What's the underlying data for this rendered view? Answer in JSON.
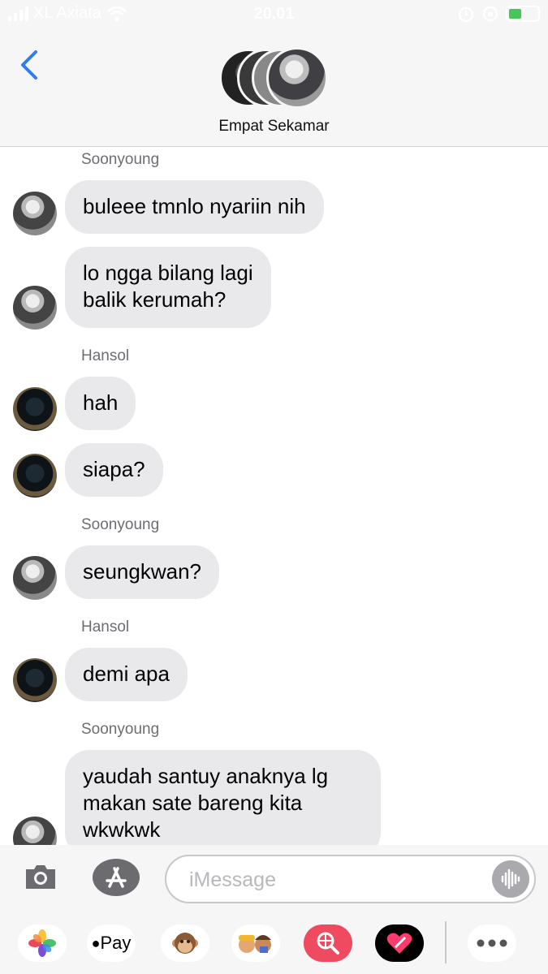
{
  "status": {
    "carrier": "XL Axiata",
    "time": "20.01"
  },
  "header": {
    "group_name": "Empat Sekamar"
  },
  "messages": [
    {
      "sender": "Soonyoung",
      "text": "buleee tmnlo nyariin nih"
    },
    {
      "text": "lo ngga bilang lagi\nbalik kerumah?"
    },
    {
      "sender": "Hansol",
      "text": "hah"
    },
    {
      "text": "siapa?"
    },
    {
      "sender": "Soonyoung",
      "text": "seungkwan?"
    },
    {
      "sender": "Hansol",
      "text": "demi apa"
    },
    {
      "sender": "Soonyoung",
      "text": "yaudah santuy anaknya lg\nmakan sate bareng kita\nwkwkwk"
    }
  ],
  "composer": {
    "placeholder": "iMessage"
  },
  "drawer": {
    "apple_pay_label": "Pay"
  },
  "colors": {
    "bubble": "#e9e9eb",
    "accent": "#2f7cf6"
  }
}
